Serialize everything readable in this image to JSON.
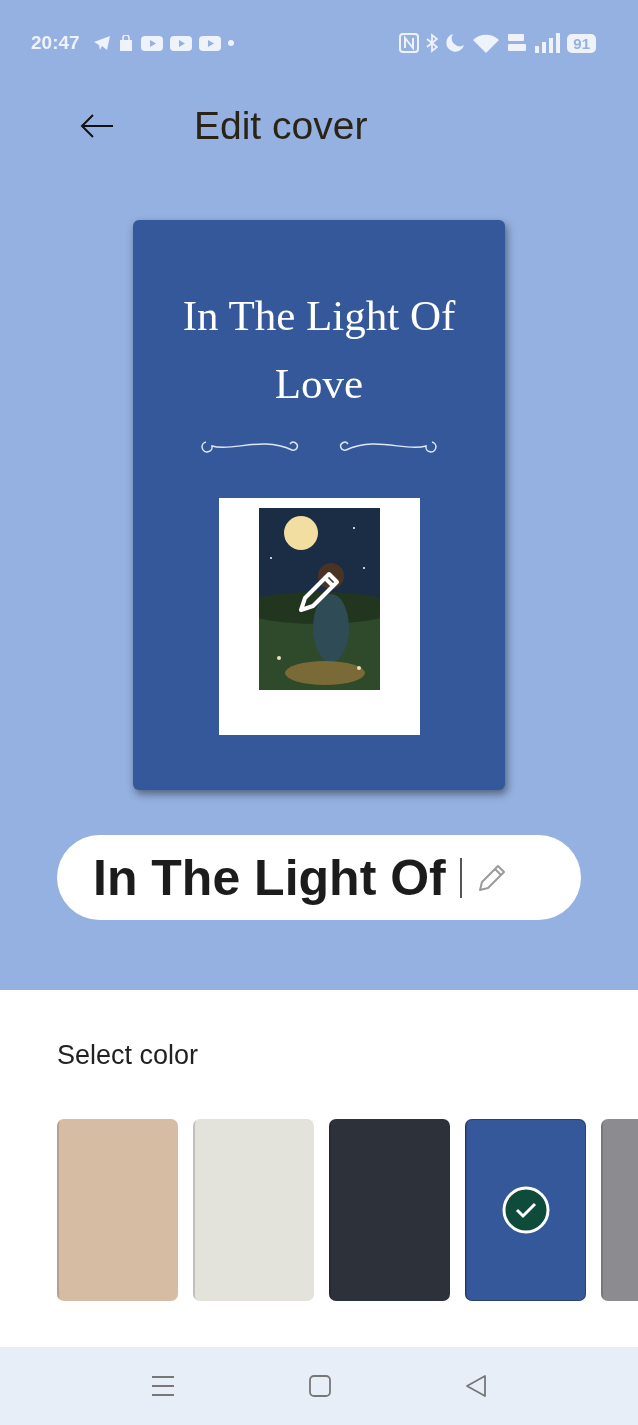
{
  "status_bar": {
    "time": "20:47",
    "battery": "91"
  },
  "header": {
    "title": "Edit cover"
  },
  "cover": {
    "title": "In The Light Of Love"
  },
  "title_field": {
    "value": "In The Light Of"
  },
  "color_picker": {
    "label": "Select color",
    "swatches": [
      {
        "color": "#d6bca2",
        "selected": false
      },
      {
        "color": "#e3e3dc",
        "selected": false
      },
      {
        "color": "#2d313a",
        "selected": false
      },
      {
        "color": "#35589a",
        "selected": true
      },
      {
        "color": "#8c8c90",
        "selected": false
      }
    ]
  }
}
